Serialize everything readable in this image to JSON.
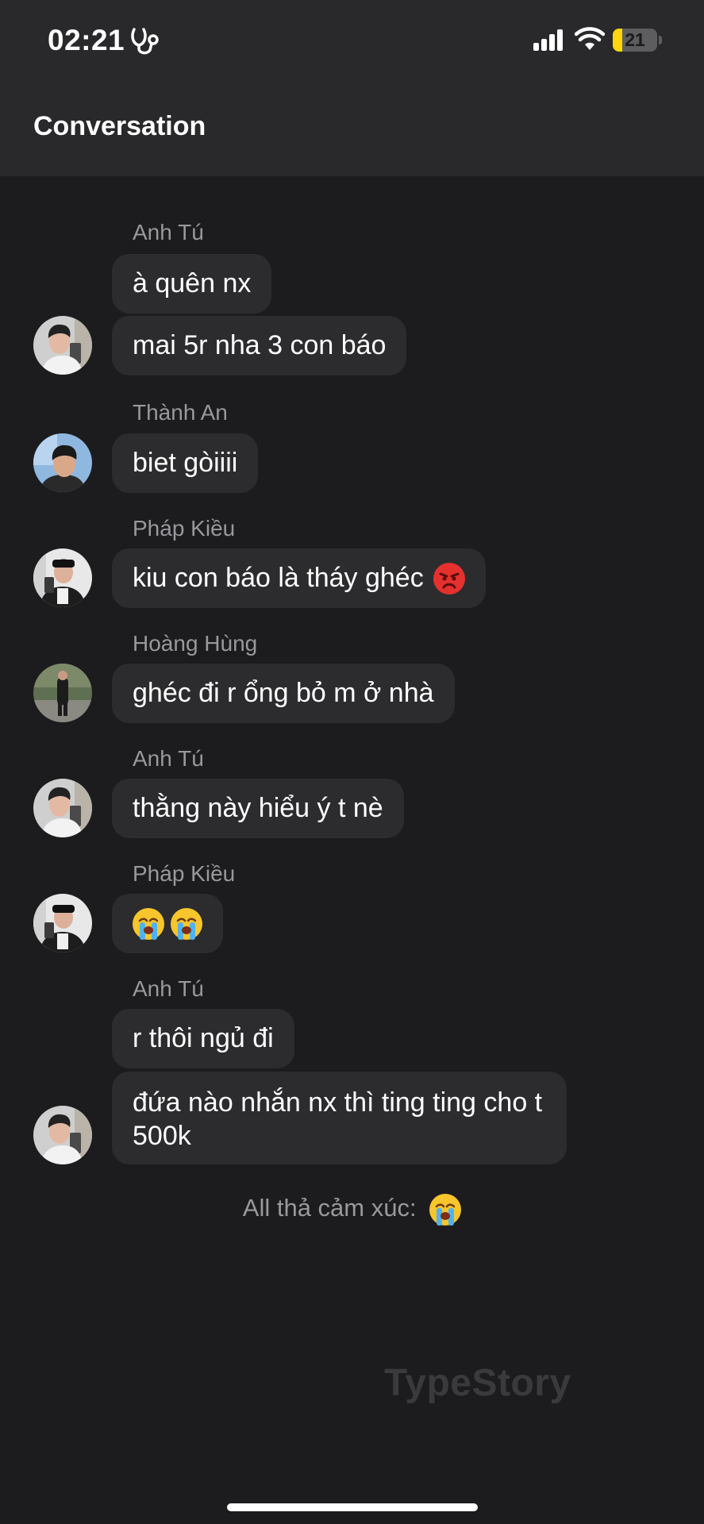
{
  "status_bar": {
    "time": "02:21",
    "battery_level": "21",
    "battery_fraction": 0.21,
    "icons": [
      "focus-icon",
      "signal-icon",
      "wifi-icon",
      "battery-icon"
    ]
  },
  "header": {
    "title": "Conversation"
  },
  "messages": [
    {
      "sender": "Anh Tú",
      "lines": [
        "à quên nx",
        "mai 5r nha 3 con báo"
      ]
    },
    {
      "sender": "Thành An",
      "lines": [
        "biet gòiiii"
      ]
    },
    {
      "sender": "Pháp Kiều",
      "lines": [
        "kiu con báo là tháy ghéc"
      ],
      "emoji": "angry-face-emoji"
    },
    {
      "sender": "Hoàng Hùng",
      "lines": [
        "ghéc đi r ổng bỏ m ở nhà"
      ]
    },
    {
      "sender": "Anh Tú",
      "lines": [
        "thằng này hiểu ý t nè"
      ]
    },
    {
      "sender": "Pháp Kiều",
      "emoji": "loudly-crying-face-emoji x2"
    },
    {
      "sender": "Anh Tú",
      "lines": [
        "r thôi ngủ đi",
        "đứa nào nhắn nx thì ting ting cho t 500k"
      ]
    }
  ],
  "reaction_note": "All thả cảm xúc:",
  "watermark": "TypeStory",
  "colors": {
    "background": "#1c1c1e",
    "header_bg": "#29292b",
    "bubble": "#2c2c2e",
    "sender_text": "#98989d",
    "battery_accent": "#ffd60a"
  }
}
